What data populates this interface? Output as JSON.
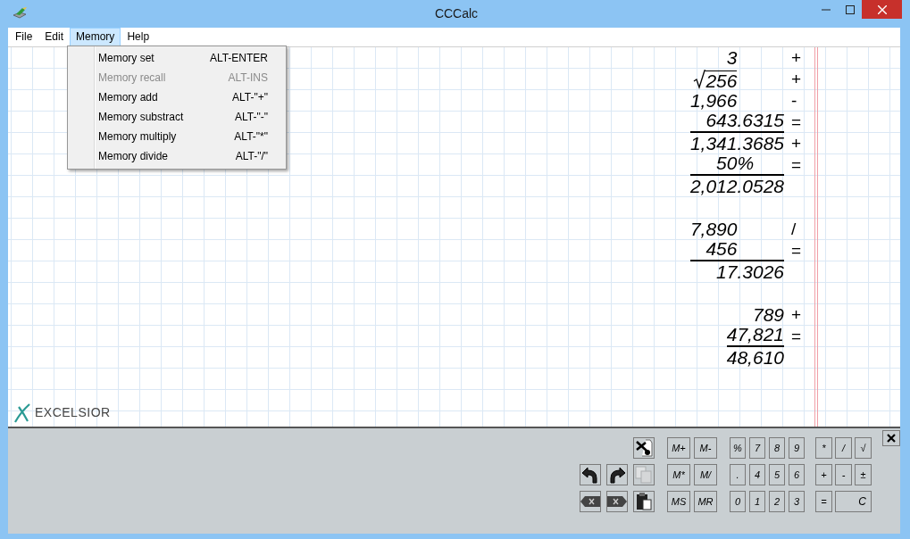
{
  "window": {
    "title": "CCCalc"
  },
  "menu_bar": [
    {
      "label": "File",
      "selected": false
    },
    {
      "label": "Edit",
      "selected": false
    },
    {
      "label": "Memory",
      "selected": true
    },
    {
      "label": "Help",
      "selected": false
    }
  ],
  "memory_menu": [
    {
      "label": "Memory set",
      "shortcut": "ALT-ENTER",
      "disabled": false
    },
    {
      "label": "Memory recall",
      "shortcut": "ALT-INS",
      "disabled": true
    },
    {
      "label": "Memory add",
      "shortcut": "ALT-\"+\"",
      "disabled": false
    },
    {
      "label": "Memory substract",
      "shortcut": "ALT-\"-\"",
      "disabled": false
    },
    {
      "label": "Memory multiply",
      "shortcut": "ALT-\"*\"",
      "disabled": false
    },
    {
      "label": "Memory divide",
      "shortcut": "ALT-\"/\"",
      "disabled": false
    }
  ],
  "tape": [
    {
      "entries": [
        {
          "value": "3",
          "operator": "+",
          "sqrt": false,
          "ruled": false
        },
        {
          "value": "256",
          "operator": "+",
          "sqrt": true,
          "ruled": false
        },
        {
          "value": "1,966",
          "operator": "-",
          "sqrt": false,
          "ruled": false
        },
        {
          "value": "643.6315",
          "operator": "=",
          "sqrt": false,
          "ruled": true
        },
        {
          "value": "1,341.3685",
          "operator": "+",
          "sqrt": false,
          "ruled": false
        },
        {
          "value": "50%",
          "operator": "=",
          "sqrt": false,
          "ruled": true
        },
        {
          "value": "2,012.0528",
          "sqrt": false,
          "ruled": false
        }
      ]
    },
    {
      "entries": [
        {
          "value": "7,890",
          "operator": "/",
          "sqrt": false,
          "ruled": false
        },
        {
          "value": "456",
          "operator": "=",
          "sqrt": false,
          "ruled": true
        },
        {
          "value": "17.3026",
          "sqrt": false,
          "ruled": false
        }
      ]
    },
    {
      "entries": [
        {
          "value": "789",
          "operator": "+",
          "sqrt": false,
          "ruled": false
        },
        {
          "value": "47,821",
          "operator": "=",
          "sqrt": false,
          "ruled": true
        },
        {
          "value": "48,610",
          "sqrt": false,
          "ruled": false
        }
      ]
    }
  ],
  "logo": "EXCELSIOR",
  "tools": [
    {
      "kind": "cut",
      "disabled": false
    },
    {
      "kind": "undo",
      "disabled": false
    },
    {
      "kind": "redo",
      "disabled": false
    },
    {
      "kind": "copy",
      "disabled": true
    },
    {
      "kind": "backspace",
      "disabled": false
    },
    {
      "kind": "delete",
      "disabled": false
    },
    {
      "kind": "paste",
      "disabled": false
    }
  ],
  "memory_keys": [
    "M+",
    "M-",
    "M*",
    "M/",
    "MS",
    "MR"
  ],
  "digit_keys": [
    "%",
    "7",
    "8",
    "9",
    ".",
    "4",
    "5",
    "6",
    "0",
    "1",
    "2",
    "3"
  ],
  "operator_keys": [
    "*",
    "/",
    "√",
    "+",
    "-",
    "±",
    "=",
    "C"
  ]
}
